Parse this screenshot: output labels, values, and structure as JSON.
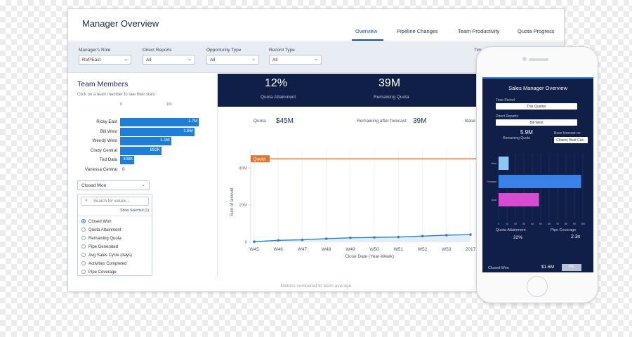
{
  "app_title": "Manager Overview",
  "tabs": [
    {
      "label": "Overview",
      "active": true
    },
    {
      "label": "Pipeline Changes",
      "active": false
    },
    {
      "label": "Team Productivity",
      "active": false
    },
    {
      "label": "Quota Progress",
      "active": false
    }
  ],
  "filters": [
    {
      "label": "Manager's Role",
      "value": "RVPEast"
    },
    {
      "label": "Direct Reports",
      "value": "All"
    },
    {
      "label": "Opportunity Type",
      "value": "All"
    },
    {
      "label": "Record Type",
      "value": "All"
    },
    {
      "label": "Tim",
      "value": ""
    }
  ],
  "team_members": {
    "title": "Team Members",
    "subtitle": "Click on a team member to see their stats",
    "axis_ticks": [
      "0",
      "1M"
    ],
    "members": [
      {
        "name": "Ricky East",
        "value_label": "1.7M",
        "value": 1.7
      },
      {
        "name": "Bill West",
        "value_label": "1.6M",
        "value": 1.6
      },
      {
        "name": "Wendy West",
        "value_label": "1.1M",
        "value": 1.1
      },
      {
        "name": "Cindy Central",
        "value_label": "892K",
        "value": 0.892
      },
      {
        "name": "Ted Data",
        "value_label": "308K",
        "value": 0.308
      },
      {
        "name": "Vanessa Central",
        "value_label": "0",
        "value": 0
      }
    ]
  },
  "metric_dropdown": {
    "value": "Closed Won",
    "search_placeholder": "Search for values...",
    "show_selected": "Show Selected (1)",
    "options": [
      {
        "label": "Closed Won",
        "selected": true
      },
      {
        "label": "Quota Attainment",
        "selected": false
      },
      {
        "label": "Remaining Quota",
        "selected": false
      },
      {
        "label": "Pipe Generated",
        "selected": false
      },
      {
        "label": "Avg Sales Cycle (days)",
        "selected": false
      },
      {
        "label": "Activities Completed",
        "selected": false
      },
      {
        "label": "Pipe Coverage",
        "selected": false
      }
    ]
  },
  "kpis": [
    {
      "value": "12%",
      "label": "Quota Attainment"
    },
    {
      "value": "39M",
      "label": "Remaining Quota"
    }
  ],
  "stats": [
    {
      "label": "Quota",
      "value": "$45M"
    },
    {
      "label": "Remaining after forecast",
      "value": "39M"
    },
    {
      "label": "Base",
      "value": ""
    }
  ],
  "chart_data": {
    "type": "line",
    "ylabel": "Sum of amount",
    "xlabel": "Close Date (Year-Week)",
    "categories": [
      "W45",
      "W46",
      "W47",
      "W48",
      "W49",
      "W50",
      "W51",
      "W52",
      "W53",
      "2017"
    ],
    "y_ticks": [
      "0",
      "20M",
      "40M"
    ],
    "ylim": [
      0,
      50
    ],
    "series": [
      {
        "values": [
          0.3,
          1.0,
          1.3,
          1.9,
          2.4,
          2.6,
          2.8,
          3.3,
          3.8,
          4.1
        ]
      }
    ],
    "reference_line": {
      "label": "Quota",
      "value": 45
    }
  },
  "footer": "Metrics compared to team average",
  "phone": {
    "title": "Sales Manager Overview",
    "time_period_label": "Time Period",
    "time_period_value": "This Quarter",
    "direct_reports_label": "Direct Reports",
    "direct_reports_value": "Bill West",
    "remaining_quota_value": "5.9M",
    "remaining_quota_label": "Remaining Quota",
    "base_forecast_label": "Base forecast on",
    "base_forecast_value": "Closed, Best Cas..",
    "bars": [
      {
        "label": "Won",
        "value": 12,
        "color": "#8ec6f5"
      },
      {
        "label": "Forecast",
        "value": 98,
        "color": "#3b82e8"
      },
      {
        "label": "Goal",
        "value": 48,
        "color": "#d54bd1"
      }
    ],
    "axis_ticks": [
      "0",
      "10",
      "20",
      "30",
      "40",
      "50",
      "60",
      "70",
      "80",
      "90",
      "100"
    ],
    "quota_attainment_label": "Quota Attainment",
    "quota_attainment_value": "22%",
    "pipe_coverage_label": "Pipe Coverage",
    "pipe_coverage_value": "2.3x",
    "closed_won_label": "Closed Won",
    "closed_won_value": "$1.6M",
    "closed_won_pct": "9%"
  }
}
